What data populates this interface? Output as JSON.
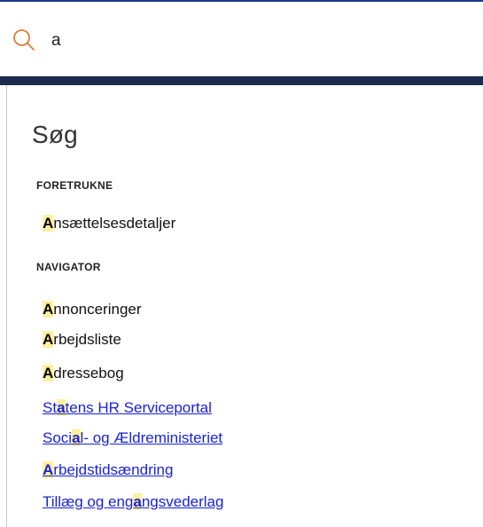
{
  "search": {
    "value": "a"
  },
  "panel": {
    "title": "Søg",
    "sections": [
      {
        "heading": "FORETRUKNE",
        "items": [
          {
            "pre": "",
            "hl": "A",
            "post": "nsættelsesdetaljer",
            "link": false
          }
        ]
      },
      {
        "heading": "NAVIGATOR",
        "items": [
          {
            "pre": "",
            "hl": "A",
            "post": "nnonceringer",
            "link": false
          },
          {
            "pre": "",
            "hl": "A",
            "post": "rbejdsliste",
            "link": false
          },
          {
            "pre": "",
            "hl": "A",
            "post": "dressebog",
            "link": false
          },
          {
            "pre": "St",
            "hl": "a",
            "post": "tens HR Serviceportal",
            "link": true
          },
          {
            "pre": "Soci",
            "hl": "a",
            "post": "l- og Ældreministeriet",
            "link": true
          },
          {
            "pre": "",
            "hl": "A",
            "post": "rbejdstidsændring",
            "link": true
          },
          {
            "pre": "Tillæg og eng",
            "hl": "a",
            "post": "ngsvederlag",
            "link": true
          }
        ]
      }
    ]
  },
  "colors": {
    "highlight": "#fff0a0",
    "link": "#1a22d6",
    "search_icon": "#e07b39",
    "header_band": "#1c2b4e"
  },
  "icons": {
    "search": "search-icon"
  }
}
